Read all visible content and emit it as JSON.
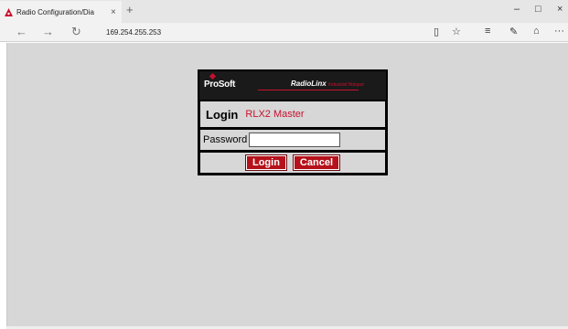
{
  "browser": {
    "tab_title": "Radio Configuration/Dia",
    "tab_close": "×",
    "new_tab": "+",
    "url": "169.254.255.253",
    "icons": {
      "back": "←",
      "forward": "→",
      "refresh": "↻",
      "reading_view": "▯",
      "favorite": "☆",
      "hub": "≡",
      "notes": "✎",
      "share": "⌂",
      "more": "···",
      "minimize": "–",
      "maximize": "□",
      "close": "×"
    }
  },
  "login": {
    "logo_text": "ProSoft",
    "product_brand": "RadioLinx",
    "product_tagline": "Industrial Hotspot",
    "heading": "Login",
    "model": "RLX2 Master",
    "password_label": "Password",
    "password_value": "",
    "login_button": "Login",
    "cancel_button": "Cancel"
  },
  "colors": {
    "accent_red": "#c8102e",
    "button_red": "#b5121b",
    "page_bg": "#d7d7d7"
  }
}
